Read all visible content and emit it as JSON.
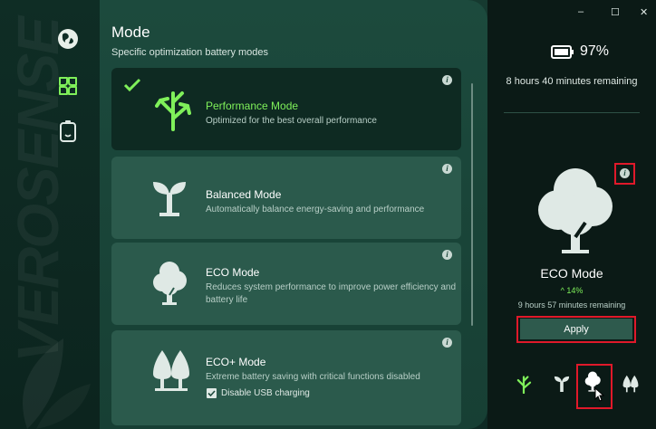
{
  "sidebar": {
    "brand": "VEROSENSE",
    "items": [
      {
        "icon": "globe-icon"
      },
      {
        "icon": "leaf-mode-icon",
        "active": true
      },
      {
        "icon": "battery-icon"
      }
    ]
  },
  "header": {
    "title": "Mode",
    "subtitle": "Specific optimization battery modes"
  },
  "modes": [
    {
      "name": "Performance Mode",
      "description": "Optimized for the best overall performance",
      "selected": true
    },
    {
      "name": "Balanced Mode",
      "description": "Automatically balance energy-saving and performance"
    },
    {
      "name": "ECO Mode",
      "description": "Reduces system performance to improve power efficiency and battery life"
    },
    {
      "name": "ECO+ Mode",
      "description": "Extreme battery saving with critical functions disabled",
      "option_label": "Disable USB charging",
      "option_checked": true
    }
  ],
  "window": {
    "minimize": "–",
    "maximize": "☐",
    "close": "✕"
  },
  "status": {
    "battery_percent": "97%",
    "remaining": "8 hours 40 minutes remaining"
  },
  "preview": {
    "mode_name": "ECO Mode",
    "gain": "14%",
    "remaining": "9 hours 57 minutes remaining",
    "apply_label": "Apply"
  },
  "colors": {
    "accent": "#7ff05a",
    "highlight": "#e0192a"
  }
}
